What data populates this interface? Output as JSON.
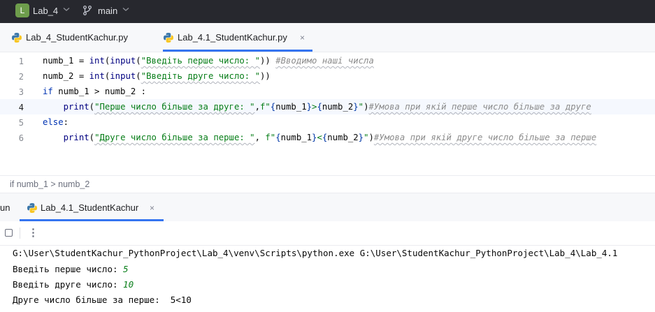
{
  "topbar": {
    "project_badge": "L",
    "project_name": "Lab_4",
    "branch": "main"
  },
  "editor_tabs": [
    {
      "label": "Lab_4_StudentKachur.py",
      "active": false
    },
    {
      "label": "Lab_4.1_StudentKachur.py",
      "active": true,
      "close": "×"
    }
  ],
  "editor": {
    "line_numbers": [
      "1",
      "2",
      "3",
      "4",
      "5",
      "6"
    ],
    "current_line": "4",
    "line1": {
      "a": "numb_1 = ",
      "int": "int",
      "b": "(",
      "input": "input",
      "c": "(",
      "str": "\"Введіть перше число: \"",
      "d": "))",
      "comment": "#Вводимо наші числа"
    },
    "line2": {
      "a": "numb_2 = ",
      "int": "int",
      "b": "(",
      "input": "input",
      "c": "(",
      "str": "\"Введіть друге число: \"",
      "d": "))"
    },
    "line3": {
      "kw": "if",
      "rest": " numb_1 > numb_2 :"
    },
    "line4": {
      "indent": "    ",
      "print": "print",
      "a": "(",
      "str1": "\"Перше число більше за друге: \"",
      "b": ",",
      "f": "f\"",
      "c1": "{",
      "v1": "numb_1",
      "c2": "}",
      "gt": ">",
      "c3": "{",
      "v2": "numb_2",
      "c4": "}",
      "q": "\"",
      "e": ")",
      "comment": "#Умова при якій перше число більше за друге"
    },
    "line5": {
      "kw": "else",
      "rest": ":"
    },
    "line6": {
      "indent": "    ",
      "print": "print",
      "a": "(",
      "str1": "\"Друге число більше за перше: \"",
      "b": ", ",
      "f": "f\"",
      "c1": "{",
      "v1": "numb_1",
      "c2": "}",
      "lt": "<",
      "c3": "{",
      "v2": "numb_2",
      "c4": "}",
      "q": "\"",
      "e": ")",
      "comment": "#Умова при якій друге число більше за перше"
    }
  },
  "breadcrumb": "if numb_1 > numb_2",
  "run_panel": {
    "stub_label": "un",
    "tab_label": "Lab_4.1_StudentKachur",
    "close": "×",
    "more": "⋮"
  },
  "console": {
    "command": "G:\\User\\StudentKachur_PythonProject\\Lab_4\\venv\\Scripts\\python.exe G:\\User\\StudentKachur_PythonProject\\Lab_4\\Lab_4.1",
    "prompt1": "Введіть перше число: ",
    "input1": "5",
    "prompt2": "Введіть друге число: ",
    "input2": "10",
    "result": "Друге число більше за перше:  5<10"
  },
  "colors": {
    "accent": "#3574f0",
    "string": "#067d17",
    "keyword": "#0033b3",
    "comment": "#8c8c8c",
    "topbar": "#27282e"
  }
}
